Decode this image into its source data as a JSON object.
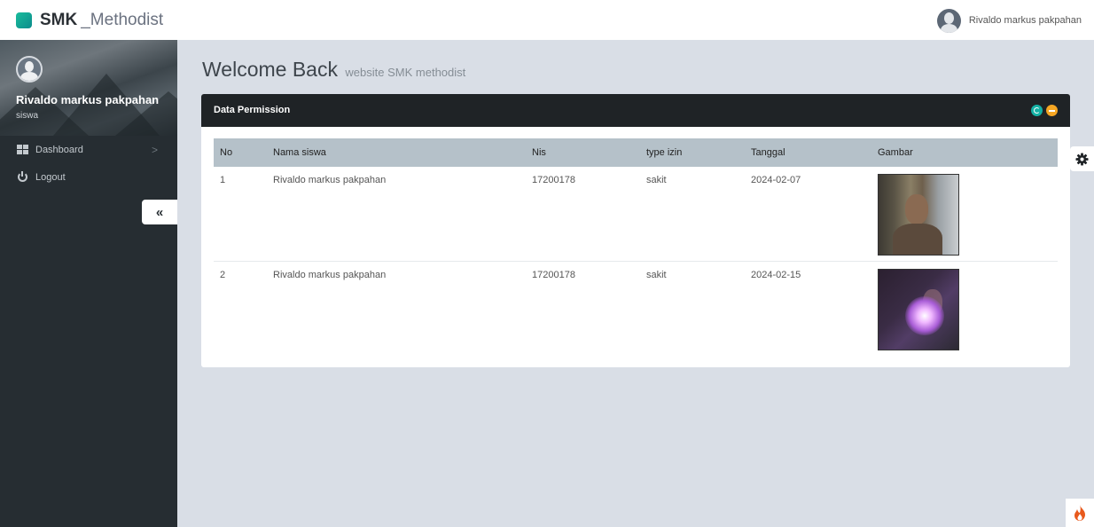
{
  "header": {
    "brand_bold": "SMK",
    "brand_light": "_Methodist",
    "user_name": "Rivaldo markus pakpahan"
  },
  "sidebar": {
    "profile_name": "Rivaldo markus pakpahan",
    "profile_role": "siswa",
    "items": [
      {
        "label": "Dashboard",
        "icon": "dashboard-grid-icon",
        "has_chevron": true
      },
      {
        "label": "Logout",
        "icon": "power-icon",
        "has_chevron": false
      }
    ],
    "chevron": ">",
    "collapse_label": "«"
  },
  "main": {
    "title": "Welcome Back",
    "subtitle": "website SMK methodist"
  },
  "card": {
    "title": "Data Permission",
    "tools": [
      {
        "name": "refresh-icon",
        "color": "#15b1a5"
      },
      {
        "name": "minimize-icon",
        "color": "#f6a623"
      }
    ]
  },
  "table": {
    "headers": [
      "No",
      "Nama siswa",
      "Nis",
      "type izin",
      "Tanggal",
      "Gambar"
    ],
    "rows": [
      {
        "no": "1",
        "nama": "Rivaldo markus pakpahan",
        "nis": "17200178",
        "type": "sakit",
        "tanggal": "2024-02-07",
        "gambar": "photo-thumbnail"
      },
      {
        "no": "2",
        "nama": "Rivaldo markus pakpahan",
        "nis": "17200178",
        "type": "sakit",
        "tanggal": "2024-02-15",
        "gambar": "photo-thumbnail"
      }
    ]
  },
  "colors": {
    "topbar": "#ffffff",
    "sidebar": "#262d32",
    "content_bg": "#d9dee6",
    "card_header": "#1f2326",
    "table_header": "#b5c1c9",
    "brand_accent": "#1abc9c"
  }
}
